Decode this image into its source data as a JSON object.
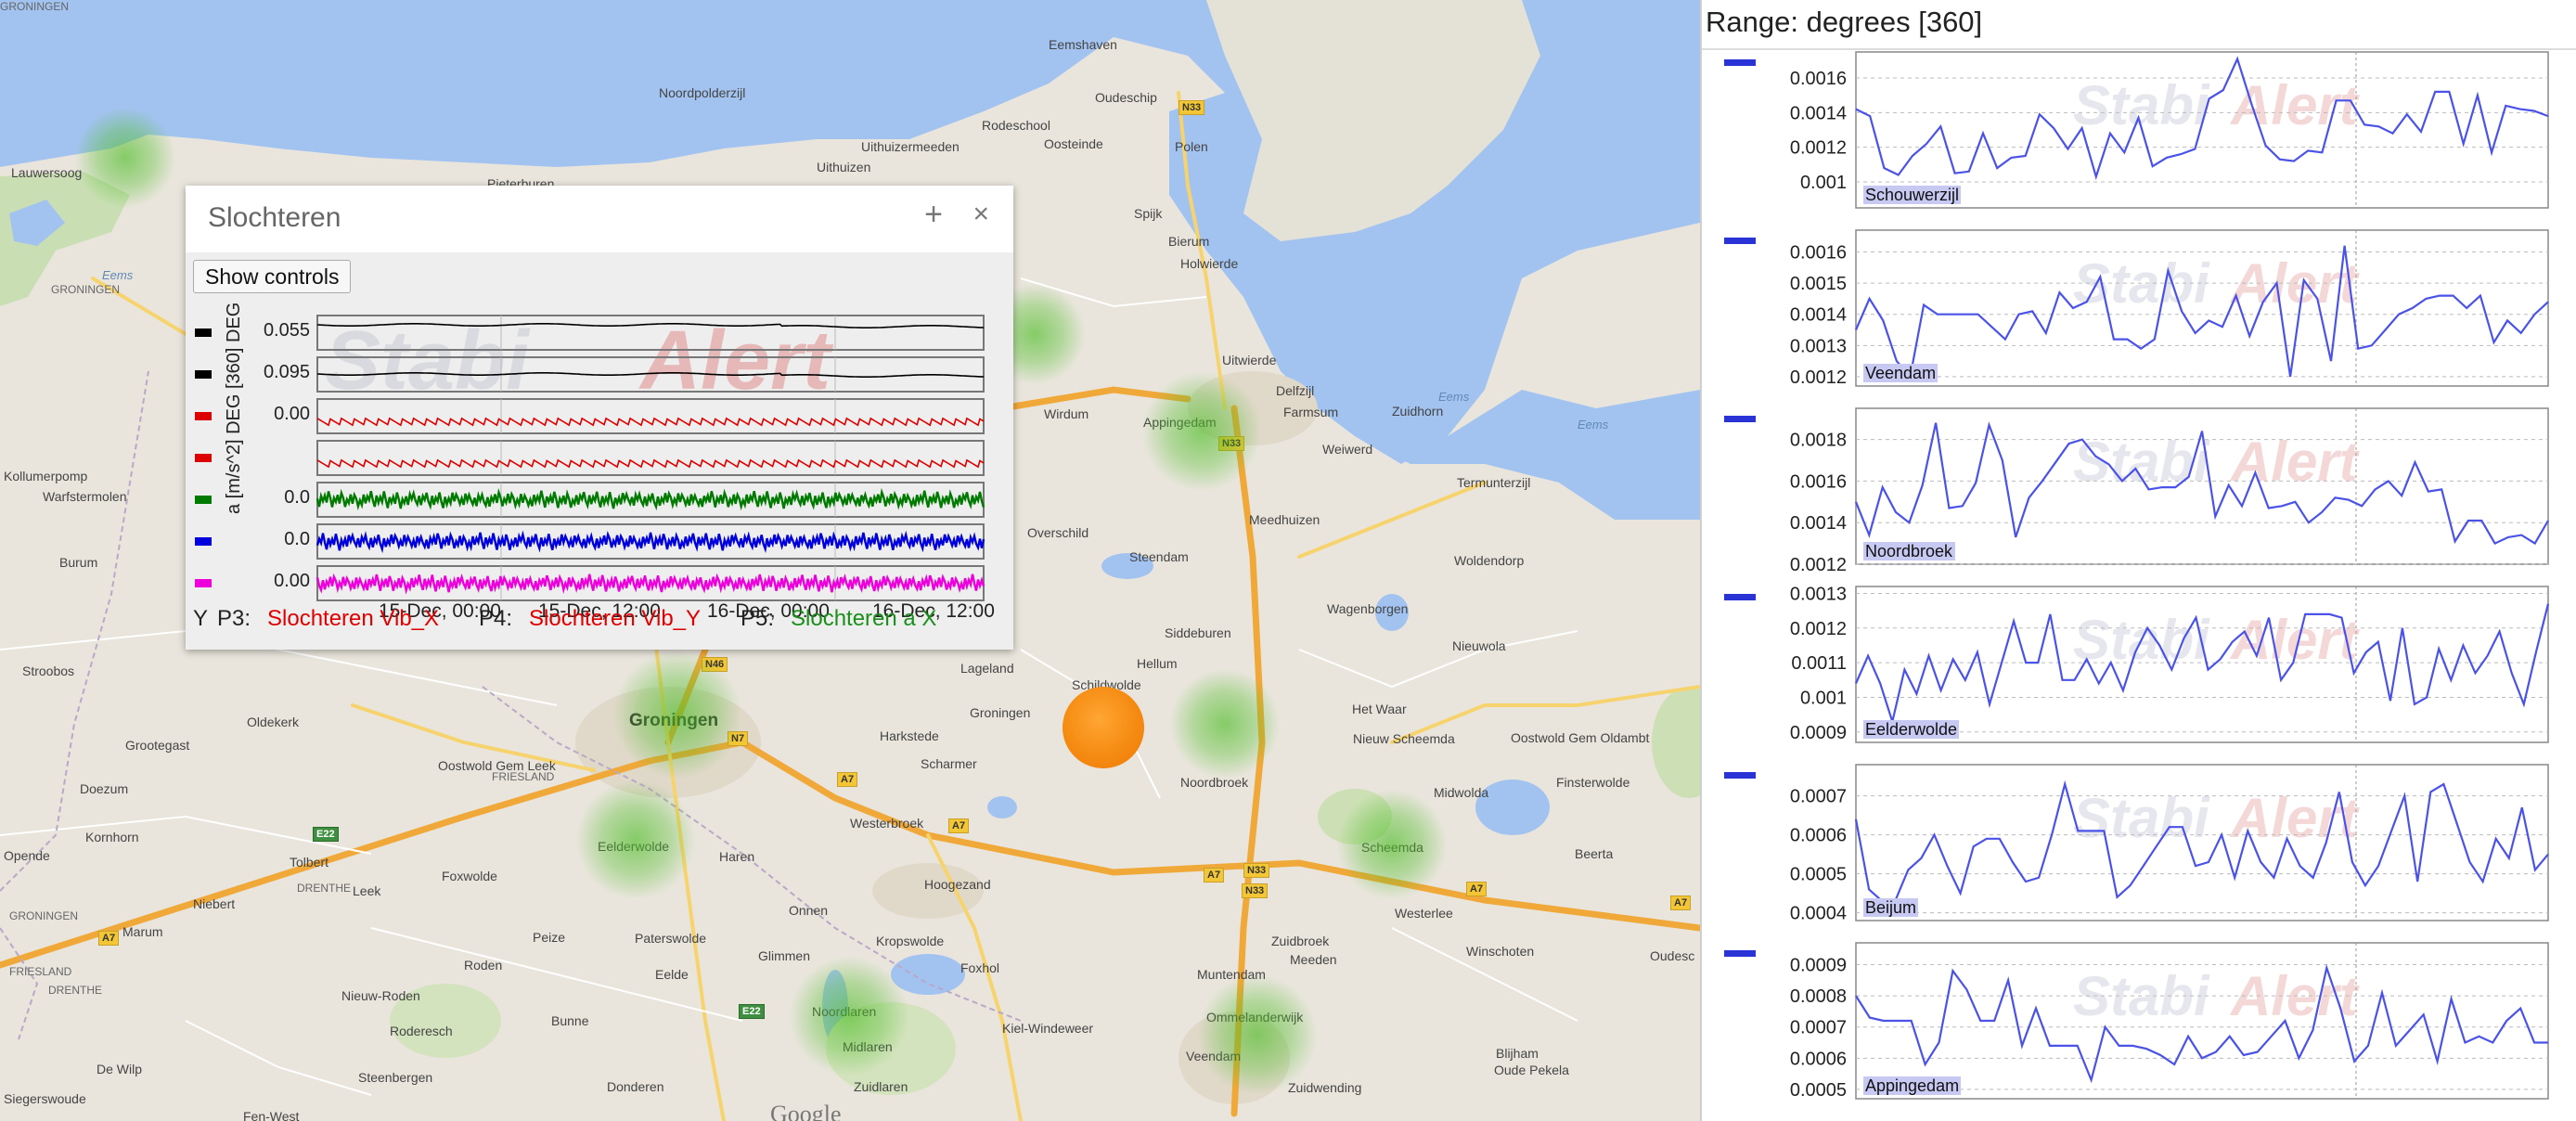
{
  "map": {
    "labels": [
      {
        "text": "Eemshaven",
        "cls": ""
      },
      {
        "text": "Noordpolderzijl",
        "cls": ""
      },
      {
        "text": "Rodeschool",
        "cls": ""
      },
      {
        "text": "Oudeschip",
        "cls": ""
      },
      {
        "text": "Uithuizermeeden",
        "cls": ""
      },
      {
        "text": "Oosteinde",
        "cls": ""
      },
      {
        "text": "Uithuizen",
        "cls": ""
      },
      {
        "text": "Pieterburen",
        "cls": ""
      },
      {
        "text": "Lauwersoog",
        "cls": ""
      },
      {
        "text": "Polen",
        "cls": ""
      },
      {
        "text": "Spijk",
        "cls": ""
      },
      {
        "text": "Bierum",
        "cls": ""
      },
      {
        "text": "Holwierde",
        "cls": ""
      },
      {
        "text": "Uitwierde",
        "cls": ""
      },
      {
        "text": "Delfzijl",
        "cls": ""
      },
      {
        "text": "Farmsum",
        "cls": ""
      },
      {
        "text": "Weiwerd",
        "cls": ""
      },
      {
        "text": "Termunterzijl",
        "cls": ""
      },
      {
        "text": "Wirdum",
        "cls": ""
      },
      {
        "text": "Appingedam",
        "cls": ""
      },
      {
        "text": "Meedhuizen",
        "cls": ""
      },
      {
        "text": "Woldendorp",
        "cls": ""
      },
      {
        "text": "Overschild",
        "cls": ""
      },
      {
        "text": "Steendam",
        "cls": ""
      },
      {
        "text": "Wagenborgen",
        "cls": ""
      },
      {
        "text": "Siddeburen",
        "cls": ""
      },
      {
        "text": "Nieuwola",
        "cls": ""
      },
      {
        "text": "Hellum",
        "cls": ""
      },
      {
        "text": "Schildwolde",
        "cls": ""
      },
      {
        "text": "Lageland",
        "cls": ""
      },
      {
        "text": "Het Waar",
        "cls": ""
      },
      {
        "text": "Nieuw Scheemda",
        "cls": ""
      },
      {
        "text": "Oostwold Gem Oldambt",
        "cls": ""
      },
      {
        "text": "Noordbroek",
        "cls": ""
      },
      {
        "text": "Harkstede",
        "cls": ""
      },
      {
        "text": "Scharmer",
        "cls": ""
      },
      {
        "text": "Groningen",
        "cls": "big"
      },
      {
        "text": "Groningen",
        "cls": ""
      },
      {
        "text": "Haren",
        "cls": ""
      },
      {
        "text": "Westerbroek",
        "cls": ""
      },
      {
        "text": "Hoogezand",
        "cls": ""
      },
      {
        "text": "Midwolda",
        "cls": ""
      },
      {
        "text": "Finsterwolde",
        "cls": ""
      },
      {
        "text": "Scheemda",
        "cls": ""
      },
      {
        "text": "Beerta",
        "cls": ""
      },
      {
        "text": "Westerlee",
        "cls": ""
      },
      {
        "text": "Winschoten",
        "cls": ""
      },
      {
        "text": "Oudesc",
        "cls": ""
      },
      {
        "text": "Onnen",
        "cls": ""
      },
      {
        "text": "Glimmen",
        "cls": ""
      },
      {
        "text": "Kropswolde",
        "cls": ""
      },
      {
        "text": "Foxhol",
        "cls": ""
      },
      {
        "text": "Meeden",
        "cls": ""
      },
      {
        "text": "Muntendam",
        "cls": ""
      },
      {
        "text": "Zuidbroek",
        "cls": ""
      },
      {
        "text": "Veendam",
        "cls": ""
      },
      {
        "text": "Zuidwending",
        "cls": ""
      },
      {
        "text": "Ommelanderwijk",
        "cls": ""
      },
      {
        "text": "Blijham",
        "cls": ""
      },
      {
        "text": "Oude Pekela",
        "cls": ""
      },
      {
        "text": "Kiel-Windeweer",
        "cls": ""
      },
      {
        "text": "Noordlaren",
        "cls": ""
      },
      {
        "text": "Midlaren",
        "cls": ""
      },
      {
        "text": "Zuidlaren",
        "cls": ""
      },
      {
        "text": "Eelde",
        "cls": ""
      },
      {
        "text": "Paterswolde",
        "cls": ""
      },
      {
        "text": "Peize",
        "cls": ""
      },
      {
        "text": "Eelderwolde",
        "cls": ""
      },
      {
        "text": "Bunne",
        "cls": ""
      },
      {
        "text": "Donderen",
        "cls": ""
      },
      {
        "text": "Roden",
        "cls": ""
      },
      {
        "text": "Leek",
        "cls": ""
      },
      {
        "text": "Foxwolde",
        "cls": ""
      },
      {
        "text": "Nieuw-Roden",
        "cls": ""
      },
      {
        "text": "Roderesch",
        "cls": ""
      },
      {
        "text": "Steenbergen",
        "cls": ""
      },
      {
        "text": "Siegerswoude",
        "cls": ""
      },
      {
        "text": "Fen-West",
        "cls": ""
      },
      {
        "text": "De Wilp",
        "cls": ""
      },
      {
        "text": "Niebert",
        "cls": ""
      },
      {
        "text": "Marum",
        "cls": ""
      },
      {
        "text": "Tolbert",
        "cls": ""
      },
      {
        "text": "Opende",
        "cls": ""
      },
      {
        "text": "Kornhorn",
        "cls": ""
      },
      {
        "text": "Doezum",
        "cls": ""
      },
      {
        "text": "Grootegast",
        "cls": ""
      },
      {
        "text": "Oldekerk",
        "cls": ""
      },
      {
        "text": "Stroobos",
        "cls": ""
      },
      {
        "text": "Burum",
        "cls": ""
      },
      {
        "text": "Warfstermolen",
        "cls": ""
      },
      {
        "text": "Kollumerpomp",
        "cls": ""
      },
      {
        "text": "Oostwold Gem Leek",
        "cls": ""
      },
      {
        "text": "Zuidhorn",
        "cls": ""
      },
      {
        "text": "Eems",
        "cls": "water"
      },
      {
        "text": "Eems",
        "cls": "water"
      },
      {
        "text": "Eems",
        "cls": "water"
      },
      {
        "text": "GRONINGEN",
        "cls": "tiny"
      },
      {
        "text": "FRIESLAND",
        "cls": "tiny"
      },
      {
        "text": "DRENTHE",
        "cls": "tiny"
      },
      {
        "text": "GRONINGEN",
        "cls": "tiny"
      },
      {
        "text": "FRIESLAND",
        "cls": "tiny"
      },
      {
        "text": "DRENTHE",
        "cls": "tiny"
      },
      {
        "text": "GRONINGEN",
        "cls": "tiny"
      }
    ],
    "shields": [
      "N33",
      "N33",
      "N33",
      "N46",
      "N7",
      "A7",
      "A7",
      "A7",
      "A7",
      "A7",
      "E22",
      "E22",
      "A7",
      "N33"
    ],
    "google": "Google"
  },
  "popup": {
    "title": "Slochteren",
    "plus": "+",
    "close": "×",
    "show_controls": "Show controls",
    "chart_data": {
      "type": "line",
      "x_ticks": [
        "15-Dec, 00:00",
        "15-Dec, 12:00",
        "16-Dec, 00:00",
        "16-Dec, 12:00"
      ],
      "ylabel": "a [m/s^2] DEG [360] DEG [360]",
      "legend": [
        {
          "prefix": "Y",
          "label": "",
          "color": "#000000"
        },
        {
          "prefix": "P3:",
          "label": "Slochteren Vib_X",
          "color": "#e00000"
        },
        {
          "prefix": "P4:",
          "label": "Slochteren Vib_Y",
          "color": "#e00000"
        },
        {
          "prefix": "P5:",
          "label": "Slochteren a X",
          "color": "#1a8f1a"
        }
      ],
      "series": [
        {
          "color": "#000000",
          "tick": "0.055",
          "type": "flat"
        },
        {
          "color": "#000000",
          "tick": "0.095",
          "type": "flat"
        },
        {
          "color": "#dd0000",
          "tick": "0.00",
          "type": "low"
        },
        {
          "color": "#dd0000",
          "tick": "",
          "type": "low"
        },
        {
          "color": "#007a00",
          "tick": "0.0",
          "type": "noise"
        },
        {
          "color": "#0000dd",
          "tick": "0.0",
          "type": "noise"
        },
        {
          "color": "#ee00dd",
          "tick": "0.00",
          "type": "noise"
        }
      ]
    }
  },
  "sidebar": {
    "range_label": "Range: degrees [360]",
    "chart_data": [
      {
        "type": "line",
        "title": "Schouwerzijl",
        "yticks": [
          "0.0016",
          "0.0014",
          "0.0012",
          "0.001"
        ],
        "ylim": [
          0.00085,
          0.00175
        ],
        "values": [
          0.00142,
          0.00138,
          0.00108,
          0.00104,
          0.00115,
          0.00122,
          0.00132,
          0.00105,
          0.00106,
          0.00128,
          0.00108,
          0.00114,
          0.00115,
          0.00139,
          0.00131,
          0.00119,
          0.00131,
          0.00103,
          0.00128,
          0.00117,
          0.00137,
          0.00109,
          0.00114,
          0.00116,
          0.00119,
          0.00148,
          0.00153,
          0.00171,
          0.00145,
          0.00121,
          0.00113,
          0.00112,
          0.00118,
          0.00117,
          0.00147,
          0.00147,
          0.00133,
          0.00132,
          0.00128,
          0.00139,
          0.00129,
          0.00152,
          0.00152,
          0.00122,
          0.0015,
          0.00117,
          0.00144,
          0.00142,
          0.00141,
          0.00138
        ]
      },
      {
        "type": "line",
        "title": "Veendam",
        "yticks": [
          "0.0016",
          "0.0015",
          "0.0014",
          "0.0013",
          "0.0012"
        ],
        "ylim": [
          0.00117,
          0.00167
        ],
        "values": [
          0.00135,
          0.00145,
          0.00138,
          0.00125,
          0.0012,
          0.00143,
          0.0014,
          0.0014,
          0.0014,
          0.0014,
          0.00136,
          0.00132,
          0.0014,
          0.00141,
          0.00134,
          0.00147,
          0.00142,
          0.00144,
          0.00152,
          0.00132,
          0.00132,
          0.00129,
          0.00132,
          0.00154,
          0.00141,
          0.00134,
          0.00138,
          0.00136,
          0.00146,
          0.00133,
          0.00144,
          0.0015,
          0.0012,
          0.00151,
          0.00145,
          0.00125,
          0.00162,
          0.00129,
          0.0013,
          0.00135,
          0.0014,
          0.00142,
          0.00145,
          0.00146,
          0.00146,
          0.00142,
          0.00146,
          0.00131,
          0.00138,
          0.00134,
          0.0014,
          0.00144
        ]
      },
      {
        "type": "line",
        "title": "Noordbroek",
        "yticks": [
          "0.0018",
          "0.0016",
          "0.0014",
          "0.0012"
        ],
        "ylim": [
          0.0012,
          0.00195
        ],
        "values": [
          0.0015,
          0.00134,
          0.00157,
          0.00145,
          0.0014,
          0.00158,
          0.00188,
          0.00147,
          0.00148,
          0.00159,
          0.00187,
          0.0017,
          0.00133,
          0.00152,
          0.0016,
          0.00169,
          0.00178,
          0.0018,
          0.00172,
          0.00168,
          0.0016,
          0.00166,
          0.00156,
          0.00157,
          0.00157,
          0.00162,
          0.00184,
          0.00143,
          0.00158,
          0.00148,
          0.00164,
          0.00147,
          0.00148,
          0.0015,
          0.0014,
          0.00145,
          0.00152,
          0.00151,
          0.00148,
          0.00156,
          0.0016,
          0.00153,
          0.00169,
          0.00155,
          0.00156,
          0.00131,
          0.00141,
          0.00141,
          0.0013,
          0.00133,
          0.00134,
          0.0013,
          0.00141
        ]
      },
      {
        "type": "line",
        "title": "Eelderwolde",
        "yticks": [
          "0.0013",
          "0.0012",
          "0.0011",
          "0.001",
          "0.0009"
        ],
        "ylim": [
          0.00087,
          0.00132
        ],
        "values": [
          0.00104,
          0.00112,
          0.00104,
          0.00093,
          0.00108,
          0.00101,
          0.00112,
          0.00102,
          0.00111,
          0.00105,
          0.00113,
          0.00098,
          0.0011,
          0.00122,
          0.0011,
          0.0011,
          0.00124,
          0.00105,
          0.00105,
          0.00111,
          0.00104,
          0.0011,
          0.00102,
          0.00113,
          0.0012,
          0.00115,
          0.00108,
          0.00117,
          0.00123,
          0.00108,
          0.00111,
          0.00116,
          0.00119,
          0.00112,
          0.00123,
          0.00105,
          0.0011,
          0.00124,
          0.00124,
          0.00124,
          0.00123,
          0.00107,
          0.00113,
          0.00116,
          0.00099,
          0.0012,
          0.00098,
          0.001,
          0.00114,
          0.00105,
          0.00115,
          0.00107,
          0.00112,
          0.00119,
          0.00107,
          0.00098,
          0.00113,
          0.00127
        ]
      },
      {
        "type": "line",
        "title": "Beijum",
        "yticks": [
          "0.0007",
          "0.0006",
          "0.0005",
          "0.0004"
        ],
        "ylim": [
          0.00038,
          0.00078
        ],
        "values": [
          0.00064,
          0.00046,
          0.00043,
          0.00043,
          0.00051,
          0.00054,
          0.0006,
          0.00052,
          0.00045,
          0.00057,
          0.00059,
          0.00059,
          0.00053,
          0.00048,
          0.00049,
          0.0006,
          0.00073,
          0.00061,
          0.00061,
          0.00061,
          0.00044,
          0.00047,
          0.00052,
          0.00057,
          0.00062,
          0.00062,
          0.00052,
          0.00053,
          0.0006,
          0.00049,
          0.00061,
          0.00053,
          0.00049,
          0.00059,
          0.00052,
          0.00049,
          0.00058,
          0.00071,
          0.00053,
          0.00047,
          0.00052,
          0.00061,
          0.0007,
          0.00048,
          0.00071,
          0.00073,
          0.00063,
          0.00053,
          0.00048,
          0.00059,
          0.00054,
          0.00067,
          0.00051,
          0.00055
        ]
      },
      {
        "type": "line",
        "title": "Appingedam",
        "yticks": [
          "0.0009",
          "0.0008",
          "0.0007",
          "0.0006",
          "0.0005"
        ],
        "ylim": [
          0.00047,
          0.00097
        ],
        "values": [
          0.0008,
          0.00073,
          0.00072,
          0.00072,
          0.00072,
          0.00058,
          0.00065,
          0.00088,
          0.00082,
          0.00072,
          0.00072,
          0.00085,
          0.00064,
          0.00076,
          0.00064,
          0.00064,
          0.00064,
          0.00053,
          0.0007,
          0.00064,
          0.00064,
          0.00063,
          0.00061,
          0.00058,
          0.00067,
          0.0006,
          0.00062,
          0.00067,
          0.00061,
          0.00062,
          0.00067,
          0.00072,
          0.0006,
          0.00069,
          0.00089,
          0.00076,
          0.00059,
          0.00064,
          0.00081,
          0.00064,
          0.00069,
          0.00074,
          0.00059,
          0.00079,
          0.00065,
          0.00067,
          0.00065,
          0.00072,
          0.00076,
          0.00065,
          0.00065
        ]
      }
    ]
  }
}
